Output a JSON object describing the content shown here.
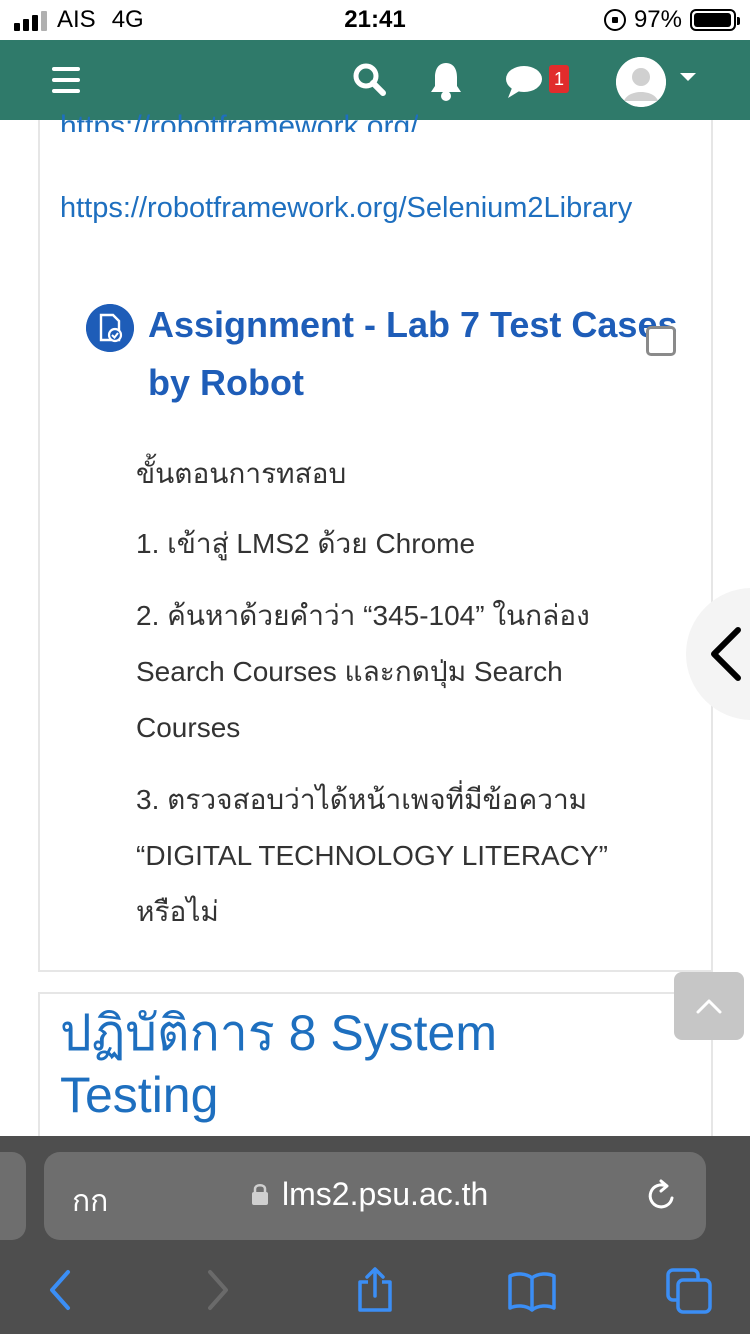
{
  "status_bar": {
    "carrier": "AIS",
    "network": "4G",
    "time": "21:41",
    "battery": "97%",
    "battery_level": 0.97
  },
  "header": {
    "icons": [
      "menu-icon",
      "search-icon",
      "bell-icon",
      "chat-icon",
      "avatar",
      "caret-down-icon"
    ],
    "message_count": "1",
    "colors": {
      "bar": "#2f7a6a",
      "badge": "#e12c2c"
    }
  },
  "content": {
    "link_cut": "https://robotframework.org/",
    "link_selenium": "https://robotframework.org/Selenium2Library",
    "assignment": {
      "title": "Assignment - Lab 7 Test Cases by Robot",
      "icon": "assignment-icon"
    },
    "description": {
      "heading": "ขั้นตอนการทสอบ",
      "step1": "1. เข้าสู่ LMS2 ด้วย Chrome",
      "step2": "2. ค้นหาด้วยคำว่า “345-104” ในกล่อง Search Courses  และกดปุ่ม Search Courses",
      "step3": "3. ตรวจสอบว่าได้หน้าเพจที่มีข้อความ “DIGITAL TECHNOLOGY LITERACY” หรือไม่"
    },
    "section_title": "ปฏิบัติการ 8 System Testing",
    "colors": {
      "link": "#1e6fbf",
      "title": "#1e5db8"
    }
  },
  "browser": {
    "text_size_button": "กก",
    "url": "lms2.psu.ac.th",
    "toolbar_icons": [
      "back-icon",
      "forward-icon",
      "share-icon",
      "bookmarks-icon",
      "tabs-icon"
    ]
  }
}
